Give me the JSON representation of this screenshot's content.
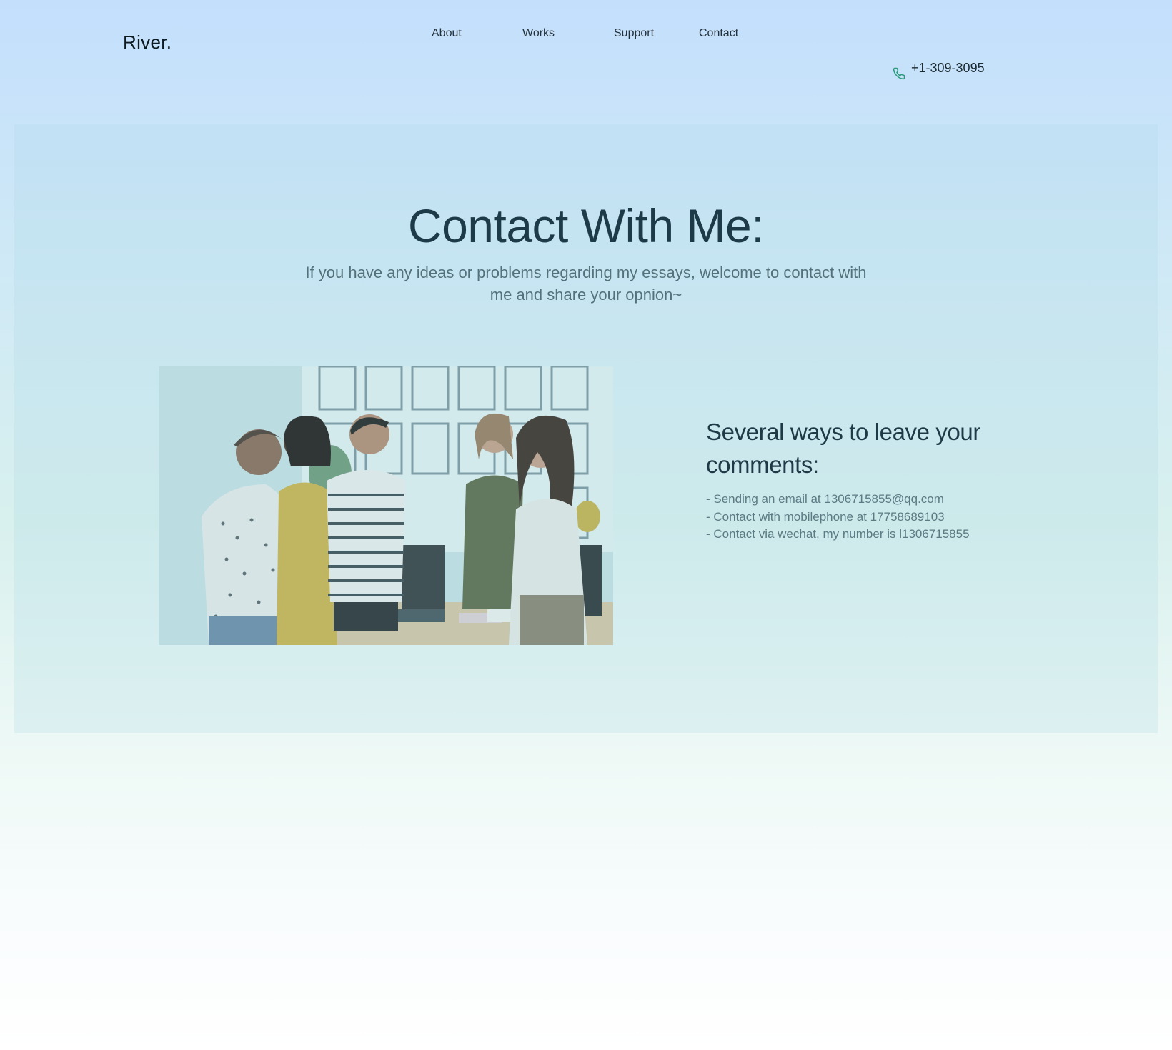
{
  "header": {
    "brand": "River.",
    "nav": [
      {
        "label": "About"
      },
      {
        "label": "Works"
      },
      {
        "label": "Support"
      },
      {
        "label": "Contact"
      }
    ],
    "phone": {
      "icon": "phone-icon",
      "number": "+1-309-3095",
      "accent": "#2a9a7a"
    }
  },
  "hero": {
    "title": "Contact With Me:",
    "subtitle": "If you have any ideas or problems regarding my essays, welcome to contact with me and share your opnion~"
  },
  "contact": {
    "photo_icon": "team-meeting-photo",
    "heading": "Several ways to leave your comments:",
    "items": [
      "- Sending an email at 1306715855@qq.com",
      "- Contact with mobilephone at 17758689103",
      "- Contact via wechat, my number is l1306715855"
    ]
  }
}
